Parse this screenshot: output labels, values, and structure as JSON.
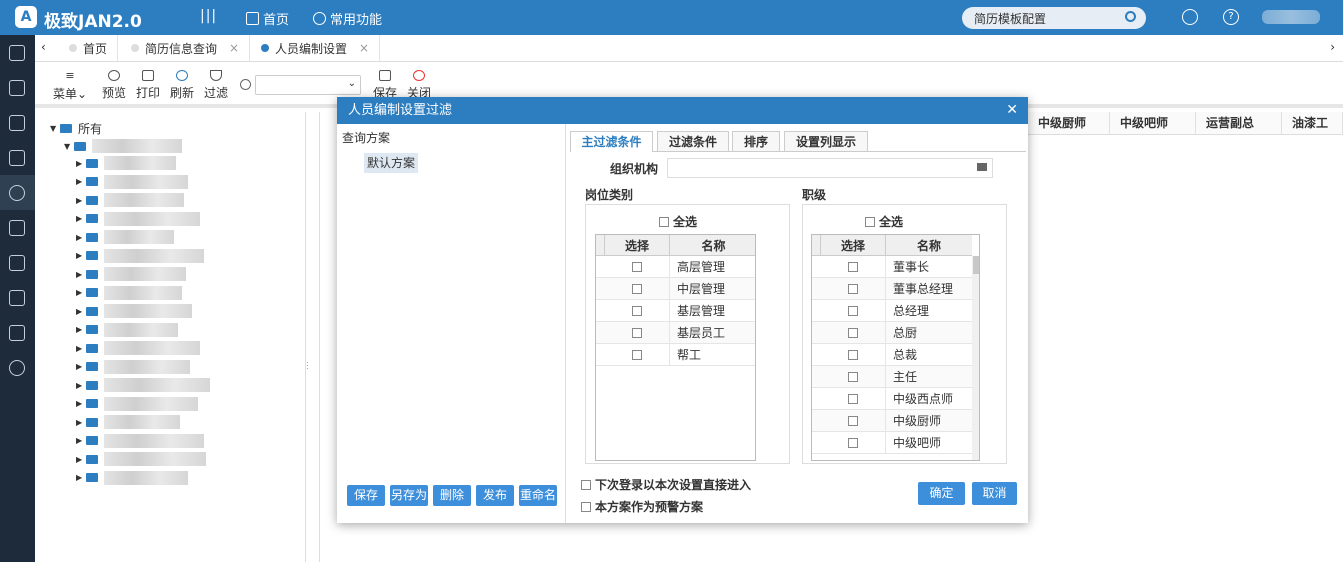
{
  "header": {
    "logo": "A",
    "title": "极致JAN2.0",
    "menu_toggle": "|||",
    "nav_home": "首页",
    "nav_common": "常用功能",
    "search_placeholder": "简历模板配置"
  },
  "tabs": [
    {
      "label": "首页"
    },
    {
      "label": "简历信息查询"
    },
    {
      "label": "人员编制设置"
    }
  ],
  "toolbar": {
    "menu": "菜单",
    "preview": "预览",
    "print": "打印",
    "refresh": "刷新",
    "filter": "过滤",
    "save": "保存",
    "close": "关闭"
  },
  "tree": {
    "root": "所有"
  },
  "grid": {
    "columns": [
      "中级厨师",
      "中级吧师",
      "运营副总",
      "油漆工"
    ]
  },
  "dialog": {
    "title": "人员编制设置过滤",
    "scheme_header": "查询方案",
    "scheme_default": "默认方案",
    "scheme_buttons": [
      "保存",
      "另存为",
      "删除",
      "发布",
      "重命名"
    ],
    "tabs": [
      "主过滤条件",
      "过滤条件",
      "排序",
      "设置列显示"
    ],
    "org_label": "组织机构",
    "post_section": "岗位类别",
    "rank_section": "职级",
    "select_all": "全选",
    "col_select": "选择",
    "col_name": "名称",
    "post_rows": [
      "高层管理",
      "中层管理",
      "基层管理",
      "基层员工",
      "帮工"
    ],
    "rank_rows": [
      "董事长",
      "董事总经理",
      "总经理",
      "总厨",
      "总裁",
      "主任",
      "中级西点师",
      "中级厨师",
      "中级吧师"
    ],
    "option_remember": "下次登录以本次设置直接进入",
    "option_warning": "本方案作为预警方案",
    "ok": "确定",
    "cancel": "取消"
  }
}
